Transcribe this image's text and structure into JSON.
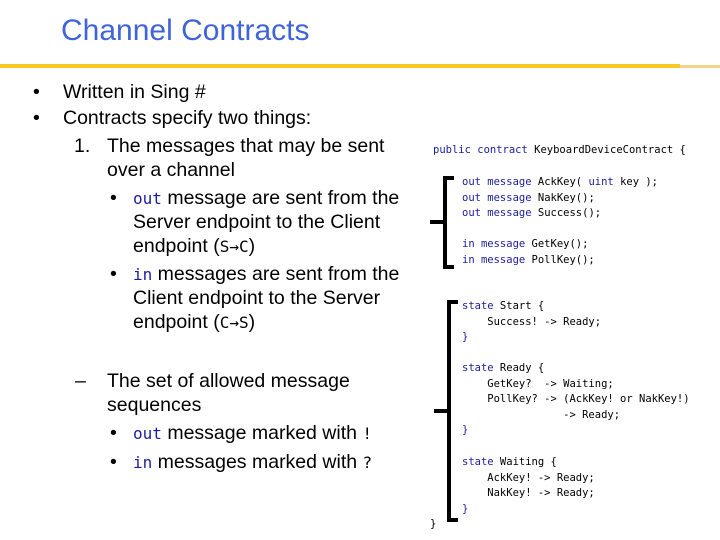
{
  "slide": {
    "title": "Channel Contracts",
    "colors": {
      "title": "#3f63d8",
      "rule": "#f7c923",
      "keyword": "#1c1ca0"
    }
  },
  "bullets": {
    "b1": {
      "marker": "•",
      "text": "Written in Sing #"
    },
    "b2": {
      "marker": "•",
      "text": "Contracts specify two things:"
    },
    "n1": {
      "marker": "1.",
      "line1": "The messages that may be sent",
      "line2": "over a channel"
    },
    "n1a": {
      "marker": "•",
      "kw": "out",
      "line1": " message are sent from the",
      "line2": "Server endpoint to the Client",
      "line3_pre": "endpoint (",
      "line3_code": "S→C",
      "line3_post": ")"
    },
    "n1b": {
      "marker": "•",
      "kw": "in",
      "line1": " messages are sent from the",
      "line2": "Client endpoint to the Server",
      "line3_pre": "endpoint (",
      "line3_code": "C→S",
      "line3_post": ")"
    },
    "n2": {
      "marker": "–",
      "line1": "The set of allowed message",
      "line2": "sequences"
    },
    "n2a": {
      "marker": "•",
      "kw": "out",
      "text": " message marked with ",
      "sym": "!"
    },
    "n2b": {
      "marker": "•",
      "kw": "in",
      "text": " messages marked with ",
      "sym": "?"
    }
  },
  "code": {
    "header": {
      "kw": "public contract",
      "rest": " KeyboardDeviceContract {"
    },
    "messages": [
      {
        "kw": "out message",
        "rest": " AckKey( uint key );",
        "kw2": "uint"
      },
      {
        "kw": "out message",
        "rest": " NakKey();"
      },
      {
        "kw": "out message",
        "rest": " Success();"
      },
      {
        "kw": "in message",
        "rest": " GetKey();"
      },
      {
        "kw": "in message",
        "rest": " PollKey();"
      }
    ],
    "states": {
      "start": {
        "kw": "state",
        "name": " Start {",
        "lines": [
          "    Success! -> Ready;"
        ],
        "close": "}"
      },
      "ready": {
        "kw": "state",
        "name": " Ready {",
        "lines": [
          "    GetKey?  -> Waiting;",
          "    PollKey? -> (AckKey! or NakKey!)",
          "                -> Ready;"
        ],
        "close": "}"
      },
      "waiting": {
        "kw": "state",
        "name": " Waiting {",
        "lines": [
          "    AckKey! -> Ready;",
          "    NakKey! -> Ready;"
        ],
        "close": "}"
      }
    },
    "final_close": "}"
  }
}
